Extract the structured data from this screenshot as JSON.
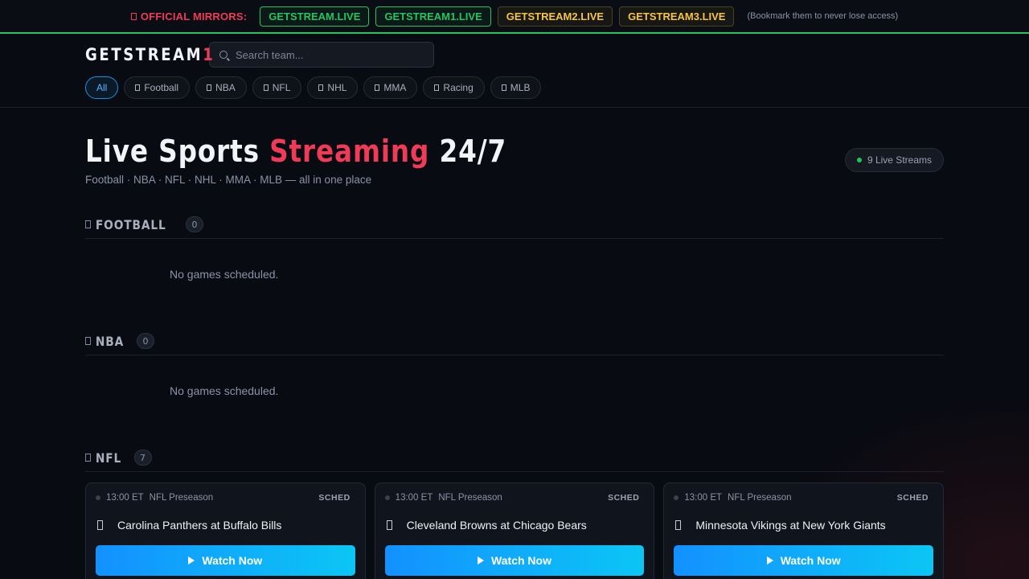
{
  "mirror_bar": {
    "label": "OFFICIAL MIRRORS:",
    "mirrors": [
      {
        "label": "GETSTREAM.LIVE",
        "color": "#22c55e"
      },
      {
        "label": "GETSTREAM1.LIVE",
        "color": "#22c55e"
      },
      {
        "label": "GETSTREAM2.LIVE",
        "color": "#f5c542"
      },
      {
        "label": "GETSTREAM3.LIVE",
        "color": "#f5c542"
      }
    ],
    "note": "(Bookmark them to never lose access)"
  },
  "header": {
    "logo_text": "GETSTREAM",
    "logo_accent": "1",
    "search_placeholder": "Search team...",
    "filters": [
      "All",
      "Football",
      "NBA",
      "NFL",
      "NHL",
      "MMA",
      "Racing",
      "MLB"
    ],
    "active_filter": "All"
  },
  "hero": {
    "title_pre": "Live Sports ",
    "title_accent": "Streaming",
    "title_post": " 24/7",
    "subtitle": "Football · NBA · NFL · NHL · MMA · MLB — all in one place",
    "live_badge": "9 Live Streams"
  },
  "sections": [
    {
      "title": "FOOTBALL",
      "count": "0",
      "empty_text": "No games scheduled."
    },
    {
      "title": "NBA",
      "count": "0",
      "empty_text": "No games scheduled."
    },
    {
      "title": "NFL",
      "count": "7",
      "games": [
        {
          "time": "13:00 ET",
          "league": "NFL Preseason",
          "status": "SCHED",
          "match": "Carolina Panthers at Buffalo Bills",
          "button": "Watch Now"
        },
        {
          "time": "13:00 ET",
          "league": "NFL Preseason",
          "status": "SCHED",
          "match": "Cleveland Browns at Chicago Bears",
          "button": "Watch Now"
        },
        {
          "time": "13:00 ET",
          "league": "NFL Preseason",
          "status": "SCHED",
          "match": "Minnesota Vikings at New York Giants",
          "button": "Watch Now"
        }
      ]
    }
  ],
  "colors": {
    "accent_red": "#ef3b57",
    "accent_blue": "#1391ff",
    "live_green": "#22c55e",
    "background": "#080b11"
  }
}
